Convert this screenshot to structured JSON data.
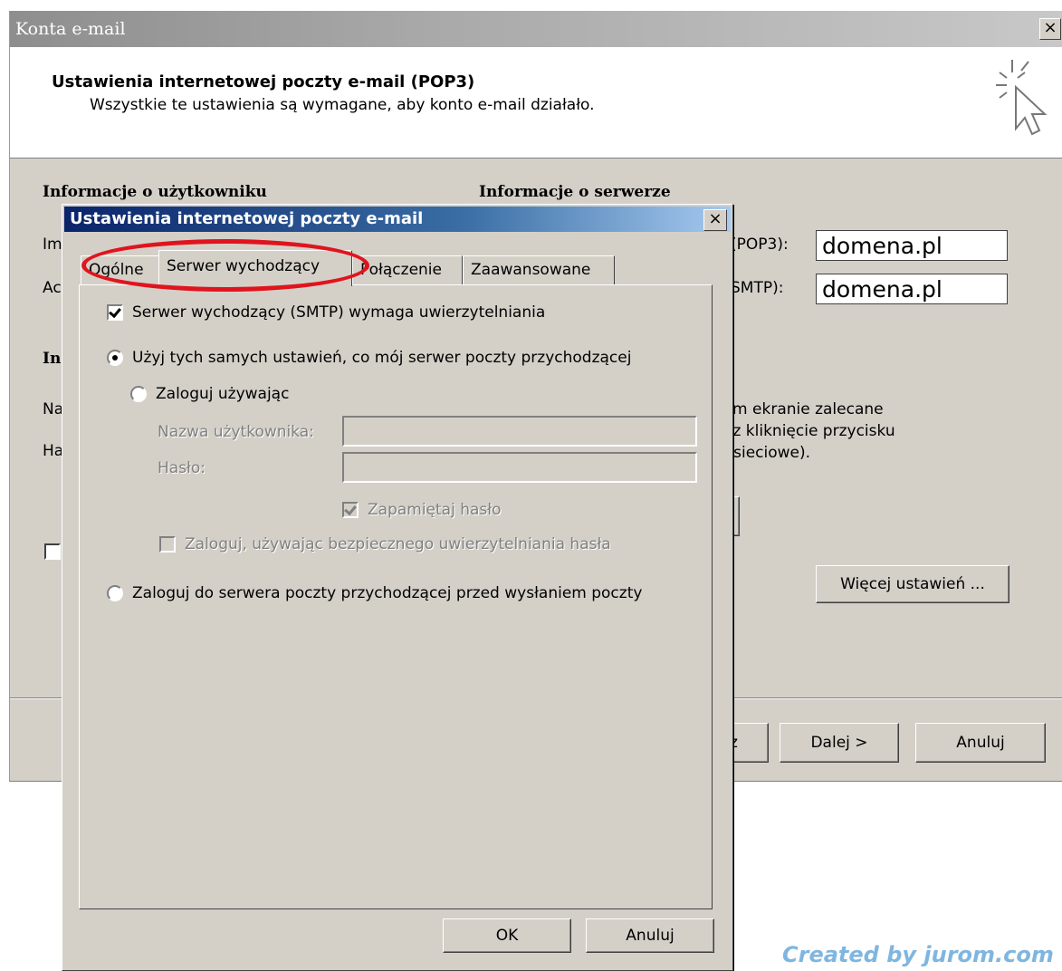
{
  "background_window": {
    "title": "Konta e-mail",
    "close_glyph": "×",
    "header_title": "Ustawienia internetowej poczty e-mail (POP3)",
    "header_subtitle": "Wszystkie te ustawienia są wymagane, aby konto e-mail działało.",
    "section_user": "Informacje o użytkowniku",
    "section_server": "Informacje o serwerze",
    "label_pop3": "(POP3):",
    "label_smtp": "SMTP):",
    "incoming_server_value": "domena.pl",
    "outgoing_server_value": "domena.pl",
    "hint_text": "ym ekranie zalecane\nez kliknięcie przycisku\n: sieciowe).",
    "more_settings_button": "Więcej ustawień ...",
    "back_button_fragment": "z",
    "next_button": "Dalej >",
    "cancel_button": "Anuluj",
    "cut_labels": [
      "Im",
      "Ac",
      "In",
      "Na",
      "Ha"
    ]
  },
  "dialog": {
    "title": "Ustawienia internetowej poczty e-mail",
    "close_glyph": "×",
    "tabs": [
      {
        "label": "Ogólne",
        "active": false
      },
      {
        "label": "Serwer wychodzący",
        "active": true
      },
      {
        "label": "Połączenie",
        "active": false
      },
      {
        "label": "Zaawansowane",
        "active": false
      }
    ],
    "smtp_auth_checkbox": {
      "label": "Serwer wychodzący (SMTP) wymaga uwierzytelniania",
      "checked": true
    },
    "radio_same_settings": {
      "label": "Użyj tych samych ustawień, co mój serwer poczty przychodzącej",
      "selected": true
    },
    "radio_login_using": {
      "label": "Zaloguj używając",
      "selected": false
    },
    "username_label": "Nazwa użytkownika:",
    "username_value": "",
    "password_label": "Hasło:",
    "password_value": "",
    "remember_password": {
      "label": "Zapamiętaj hasło",
      "checked": true,
      "disabled": true
    },
    "spa_checkbox": {
      "label": "Zaloguj, używając bezpiecznego uwierzytelniania hasła",
      "checked": false,
      "disabled": true
    },
    "radio_login_before_send": {
      "label": "Zaloguj do serwera poczty przychodzącej przed wysłaniem poczty",
      "selected": false
    },
    "ok_button": "OK",
    "cancel_button": "Anuluj"
  },
  "watermark": "Created by jurom.com",
  "colors": {
    "dialog_face": "#d4d0c8",
    "active_title_start": "#0a246a",
    "highlight_ellipse": "#e0141e",
    "watermark": "#7fb6e0"
  }
}
